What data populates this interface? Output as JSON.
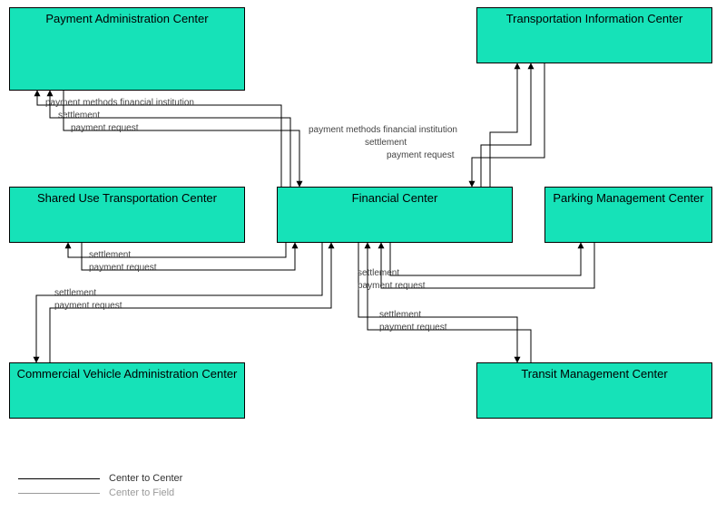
{
  "boxes": {
    "payment_admin": "Payment Administration Center",
    "transport_info": "Transportation Information Center",
    "shared_use": "Shared Use Transportation Center",
    "financial": "Financial Center",
    "parking": "Parking Management Center",
    "commercial": "Commercial Vehicle Administration Center",
    "transit": "Transit Management Center"
  },
  "labels": {
    "pmfi": "payment methods financial institution",
    "settlement": "settlement",
    "payreq": "payment request"
  },
  "legend": {
    "c2c": "Center to Center",
    "c2f": "Center to Field"
  }
}
